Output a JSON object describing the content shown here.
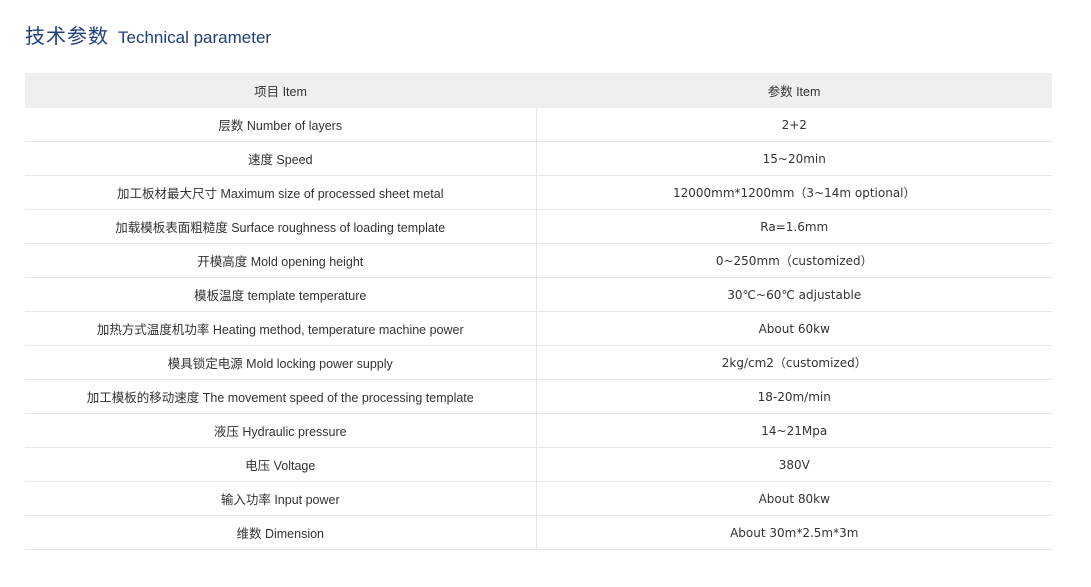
{
  "heading": {
    "title_cn": "技术参数",
    "title_en": "Technical parameter"
  },
  "table": {
    "headers": [
      "项目 Item",
      "参数 Item"
    ],
    "rows": [
      {
        "item": "层数  Number of layers",
        "value": "2+2"
      },
      {
        "item": "速度  Speed",
        "value": "15~20min"
      },
      {
        "item": "加工板材最大尺寸  Maximum size of processed sheet metal",
        "value": "12000mm*1200mm（3~14m optional）"
      },
      {
        "item": "加载模板表面粗糙度  Surface roughness of loading template",
        "value": "Ra=1.6mm"
      },
      {
        "item": "开模高度   Mold opening height",
        "value": "0~250mm（customized）"
      },
      {
        "item": "模板温度   template temperature",
        "value": "30℃~60℃ adjustable"
      },
      {
        "item": "加热方式温度机功率  Heating method, temperature machine power",
        "value": "About 60kw"
      },
      {
        "item": "模具锁定电源  Mold locking power supply",
        "value": "2kg/cm2（customized）"
      },
      {
        "item": "加工模板的移动速度 The movement speed of the processing template",
        "value": "18-20m/min"
      },
      {
        "item": "液压  Hydraulic pressure",
        "value": "14~21Mpa"
      },
      {
        "item": "电压  Voltage",
        "value": "380V"
      },
      {
        "item": "输入功率  Input power",
        "value": "About 80kw"
      },
      {
        "item": "维数  Dimension",
        "value": "About 30m*2.5m*3m"
      }
    ]
  }
}
